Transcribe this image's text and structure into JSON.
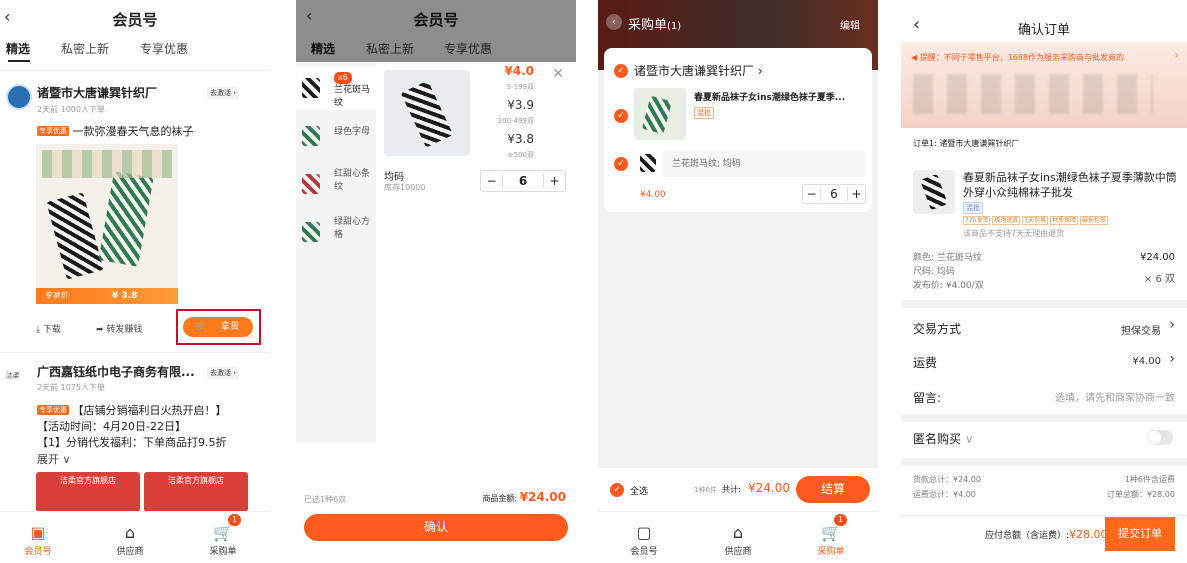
{
  "p1": {
    "back": "‹",
    "title": "会员号",
    "tabs": [
      "精选",
      "私密上新",
      "专享优惠"
    ],
    "shop1": {
      "name": "诸暨市大唐谦巽针织厂",
      "meta": "2天前  1000人下单",
      "follow": "去激活 ›",
      "tag": "专享优惠",
      "desc": "一款弥漫春天气息的袜子",
      "price_label": "专享价",
      "price": "¥ 3.8",
      "download": "下载",
      "share": "转发赚钱",
      "buy": "拿货"
    },
    "shop2": {
      "name": "广西嘉钰纸巾电子商务有限...",
      "meta": "2天前  1075人下单",
      "follow": "去激活 ›",
      "tag": "专享优惠",
      "line1": "【店铺分销福利日火热开启！】",
      "line2": "【活动时间：4月20日-22日】",
      "line3": "【1】分销代发福利：下单商品打9.5折",
      "expand": "展开 ∨",
      "img1": "洁柔官方旗舰店",
      "img2": "洁柔官方旗舰店"
    },
    "tabbar": {
      "t1": "会员号",
      "t2": "供应商",
      "t3": "采购单",
      "badge": "1"
    }
  },
  "p2": {
    "back": "‹",
    "title": "会员号",
    "tabs": [
      "精选",
      "私密上新",
      "专享优惠"
    ],
    "variants": [
      {
        "label": "兰花斑马纹",
        "badge": "x6"
      },
      {
        "label": "绿色字母"
      },
      {
        "label": "红甜心条纹"
      },
      {
        "label": "绿甜心方格"
      }
    ],
    "tiers": [
      {
        "price": "¥4.0",
        "range": "3-199双"
      },
      {
        "price": "¥3.9",
        "range": "200-499双"
      },
      {
        "price": "¥3.8",
        "range": "≥500双"
      }
    ],
    "size": "均码",
    "stock": "库存10000",
    "qty": "6",
    "selected": "已选1种6双",
    "amount_label": "商品金额:",
    "amount": "¥24.00",
    "confirm": "确认",
    "close": "✕"
  },
  "p3": {
    "back": "‹",
    "title": "采购单",
    "count": "(1)",
    "edit": "编辑",
    "shop": "诸暨市大唐谦巽针织厂 ›",
    "product": "春夏新品袜子女ins潮绿色袜子夏季...",
    "tag": "混批",
    "sku": "兰花斑马纹; 均码",
    "price": "¥4.00",
    "qty": "6",
    "select_all": "全选",
    "summary_small": "1种6件",
    "total_label": "共计:",
    "total": "¥24.00",
    "checkout": "结算",
    "tabbar": {
      "t1": "会员号",
      "t2": "供应商",
      "t3": "采购单",
      "badge": "1"
    }
  },
  "p4": {
    "back": "‹",
    "title": "确认订单",
    "notice": "提醒：不同于零售平台，1688作为服务采购商与批发商的",
    "order_no": "订单1: 诸暨市大唐谦巽针织厂",
    "product": "春夏新品袜子女ins潮绿色袜子夏季薄款中筒外穿小众纯棉袜子批发",
    "tag": "混批",
    "services": [
      "72h发货",
      "极速退款",
      "7天包换",
      "材质保障",
      "破损包赔"
    ],
    "no_return": "该商品不支持7天无理由退货",
    "color": "颜色: 兰花斑马纹",
    "size": "尺码: 均码",
    "pub_price": "发布价: ¥4.00/双",
    "line_price": "¥24.00",
    "line_qty": "× 6 双",
    "trade_label": "交易方式",
    "trade_value": "担保交易",
    "freight_label": "运费",
    "freight_value": "¥4.00",
    "msg_label": "留言:",
    "msg_placeholder": "选填，请先和商家协商一致",
    "anon_label": "匿名购买",
    "goods_total": "货款总计：¥24.00",
    "ship_total": "运费总计：¥4.00",
    "kinds": "1种6件含运费",
    "order_total": "订单总额：¥28.00",
    "pay_label": "应付总额（含运费）:",
    "pay_amount": "¥28.00",
    "submit": "提交订单"
  }
}
